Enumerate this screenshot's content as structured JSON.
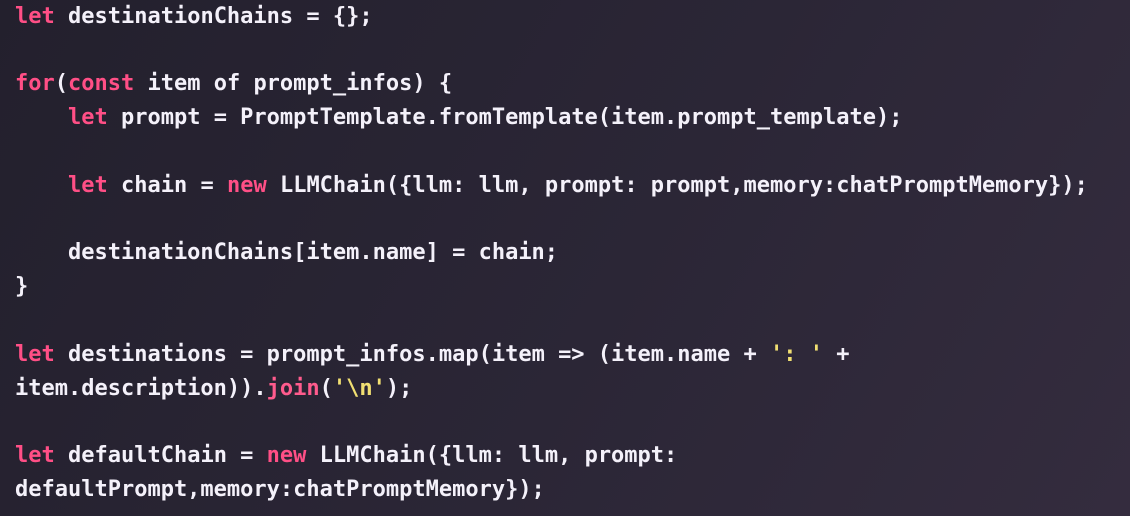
{
  "editor": {
    "lines": [
      [
        {
          "t": "let",
          "c": "kw"
        },
        {
          "t": " destinationChains = {};",
          "c": "pl"
        }
      ],
      [],
      [
        {
          "t": "for",
          "c": "kw"
        },
        {
          "t": "(",
          "c": "pl"
        },
        {
          "t": "const",
          "c": "kw"
        },
        {
          "t": " item of prompt_infos) {",
          "c": "pl"
        }
      ],
      [
        {
          "t": "    ",
          "c": "pl"
        },
        {
          "t": "let",
          "c": "kw"
        },
        {
          "t": " prompt = PromptTemplate.fromTemplate(item.prompt_template);",
          "c": "pl"
        }
      ],
      [],
      [
        {
          "t": "    ",
          "c": "pl"
        },
        {
          "t": "let",
          "c": "kw"
        },
        {
          "t": " chain = ",
          "c": "pl"
        },
        {
          "t": "new",
          "c": "kw"
        },
        {
          "t": " LLMChain({llm: llm, prompt: prompt,memory:chatPromptMemory});",
          "c": "pl"
        }
      ],
      [],
      [
        {
          "t": "    destinationChains[item.name] = chain;",
          "c": "pl"
        }
      ],
      [
        {
          "t": "}",
          "c": "pl"
        }
      ],
      [],
      [
        {
          "t": "let",
          "c": "kw"
        },
        {
          "t": " destinations = prompt_infos.map(item => (item.name + ",
          "c": "pl"
        },
        {
          "t": "': '",
          "c": "str"
        },
        {
          "t": " +",
          "c": "pl"
        }
      ],
      [
        {
          "t": "item.description)).",
          "c": "pl"
        },
        {
          "t": "join",
          "c": "fn"
        },
        {
          "t": "(",
          "c": "pl"
        },
        {
          "t": "'\\n'",
          "c": "str"
        },
        {
          "t": ");",
          "c": "pl"
        }
      ],
      [],
      [
        {
          "t": "let",
          "c": "kw"
        },
        {
          "t": " defaultChain = ",
          "c": "pl"
        },
        {
          "t": "new",
          "c": "kw"
        },
        {
          "t": " LLMChain({llm: llm, prompt:",
          "c": "pl"
        }
      ],
      [
        {
          "t": "defaultPrompt,memory:chatPromptMemory});",
          "c": "pl"
        }
      ]
    ]
  }
}
